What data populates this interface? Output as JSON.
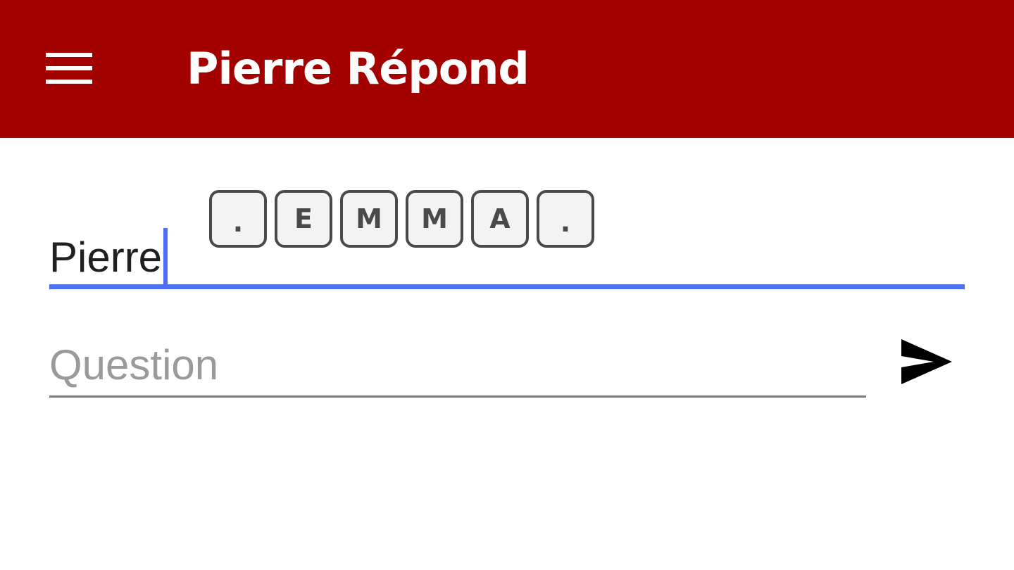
{
  "appbar": {
    "title": "Pierre Répond",
    "menu_icon": "menu-icon",
    "color": "#a30000"
  },
  "answer_field": {
    "value": "Pierre",
    "accent_color": "#5070f4",
    "hint_keys": [
      ".",
      "E",
      "M",
      "M",
      "A",
      "."
    ]
  },
  "question_field": {
    "value": "",
    "placeholder": "Question"
  },
  "send": {
    "icon": "send-icon"
  }
}
